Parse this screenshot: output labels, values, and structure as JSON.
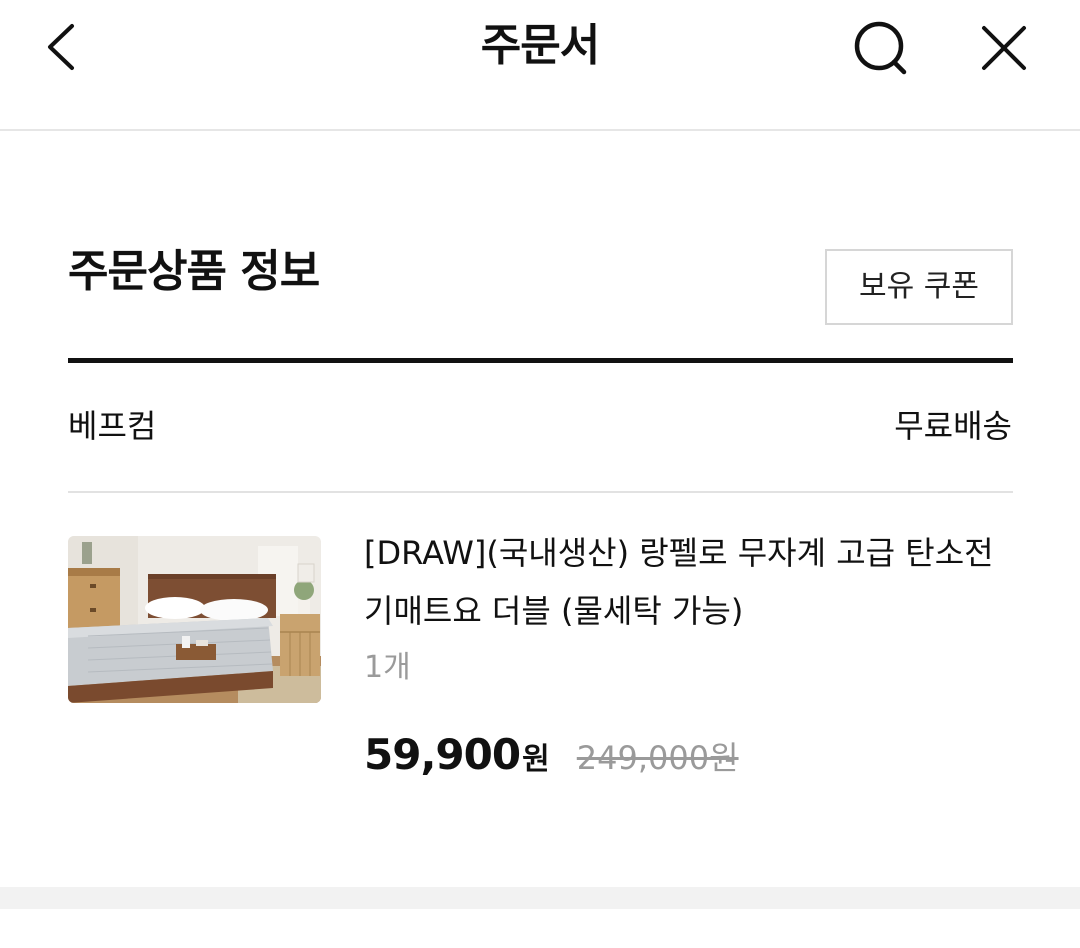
{
  "header": {
    "title": "주문서",
    "back_icon": "chevron-left-icon",
    "search_icon": "search-icon",
    "close_icon": "close-icon"
  },
  "section": {
    "title": "주문상품 정보",
    "coupon_button_label": "보유 쿠폰"
  },
  "seller": {
    "name": "베프컴",
    "shipping": "무료배송"
  },
  "product": {
    "name": "[DRAW](국내생산) 랑펠로 무자계 고급 탄소전기매트요 더블 (물세탁 가능)",
    "quantity": "1개",
    "sale_price": "59,900",
    "sale_price_unit": "원",
    "original_price": "249,000원"
  },
  "colors": {
    "text": "#111111",
    "muted": "#9a9a9a",
    "divider": "#e2e2e2",
    "band": "#f2f2f2"
  }
}
